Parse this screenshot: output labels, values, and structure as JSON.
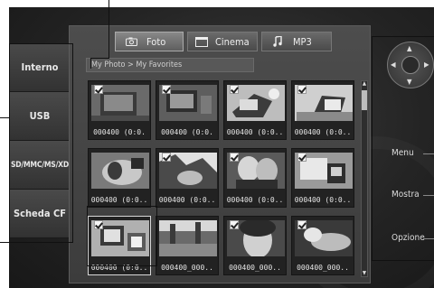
{
  "devices": [
    {
      "label": "Interno"
    },
    {
      "label": "USB"
    },
    {
      "label": "SD/MMC/MS/XD"
    },
    {
      "label": "Scheda CF"
    }
  ],
  "tabs": [
    {
      "label": "Foto",
      "icon": "camera-icon",
      "active": true
    },
    {
      "label": "Cinema",
      "icon": "film-icon",
      "active": false
    },
    {
      "label": "MP3",
      "icon": "music-note-icon",
      "active": false
    }
  ],
  "breadcrumb": "My Photo > My Favorites",
  "thumbnails": [
    {
      "caption": "000400 (0:0.",
      "checked": true
    },
    {
      "caption": "000400 (0:0.",
      "checked": true
    },
    {
      "caption": "000400 (0:0..",
      "checked": true
    },
    {
      "caption": "000400 (0:0..",
      "checked": true
    },
    {
      "caption": "000400 (0:0..",
      "checked": false
    },
    {
      "caption": "000400 (0:0..",
      "checked": true
    },
    {
      "caption": "000400 (0:0..",
      "checked": true
    },
    {
      "caption": "000400 (0:0..",
      "checked": true
    },
    {
      "caption": "000400 (0:0..",
      "checked": true
    },
    {
      "caption": "000400_000..",
      "checked": false
    },
    {
      "caption": "000400_000..",
      "checked": true
    },
    {
      "caption": "000400_000..",
      "checked": true
    }
  ],
  "remote": {
    "menu": "Menu",
    "show": "Mostra",
    "option": "Opzione"
  }
}
